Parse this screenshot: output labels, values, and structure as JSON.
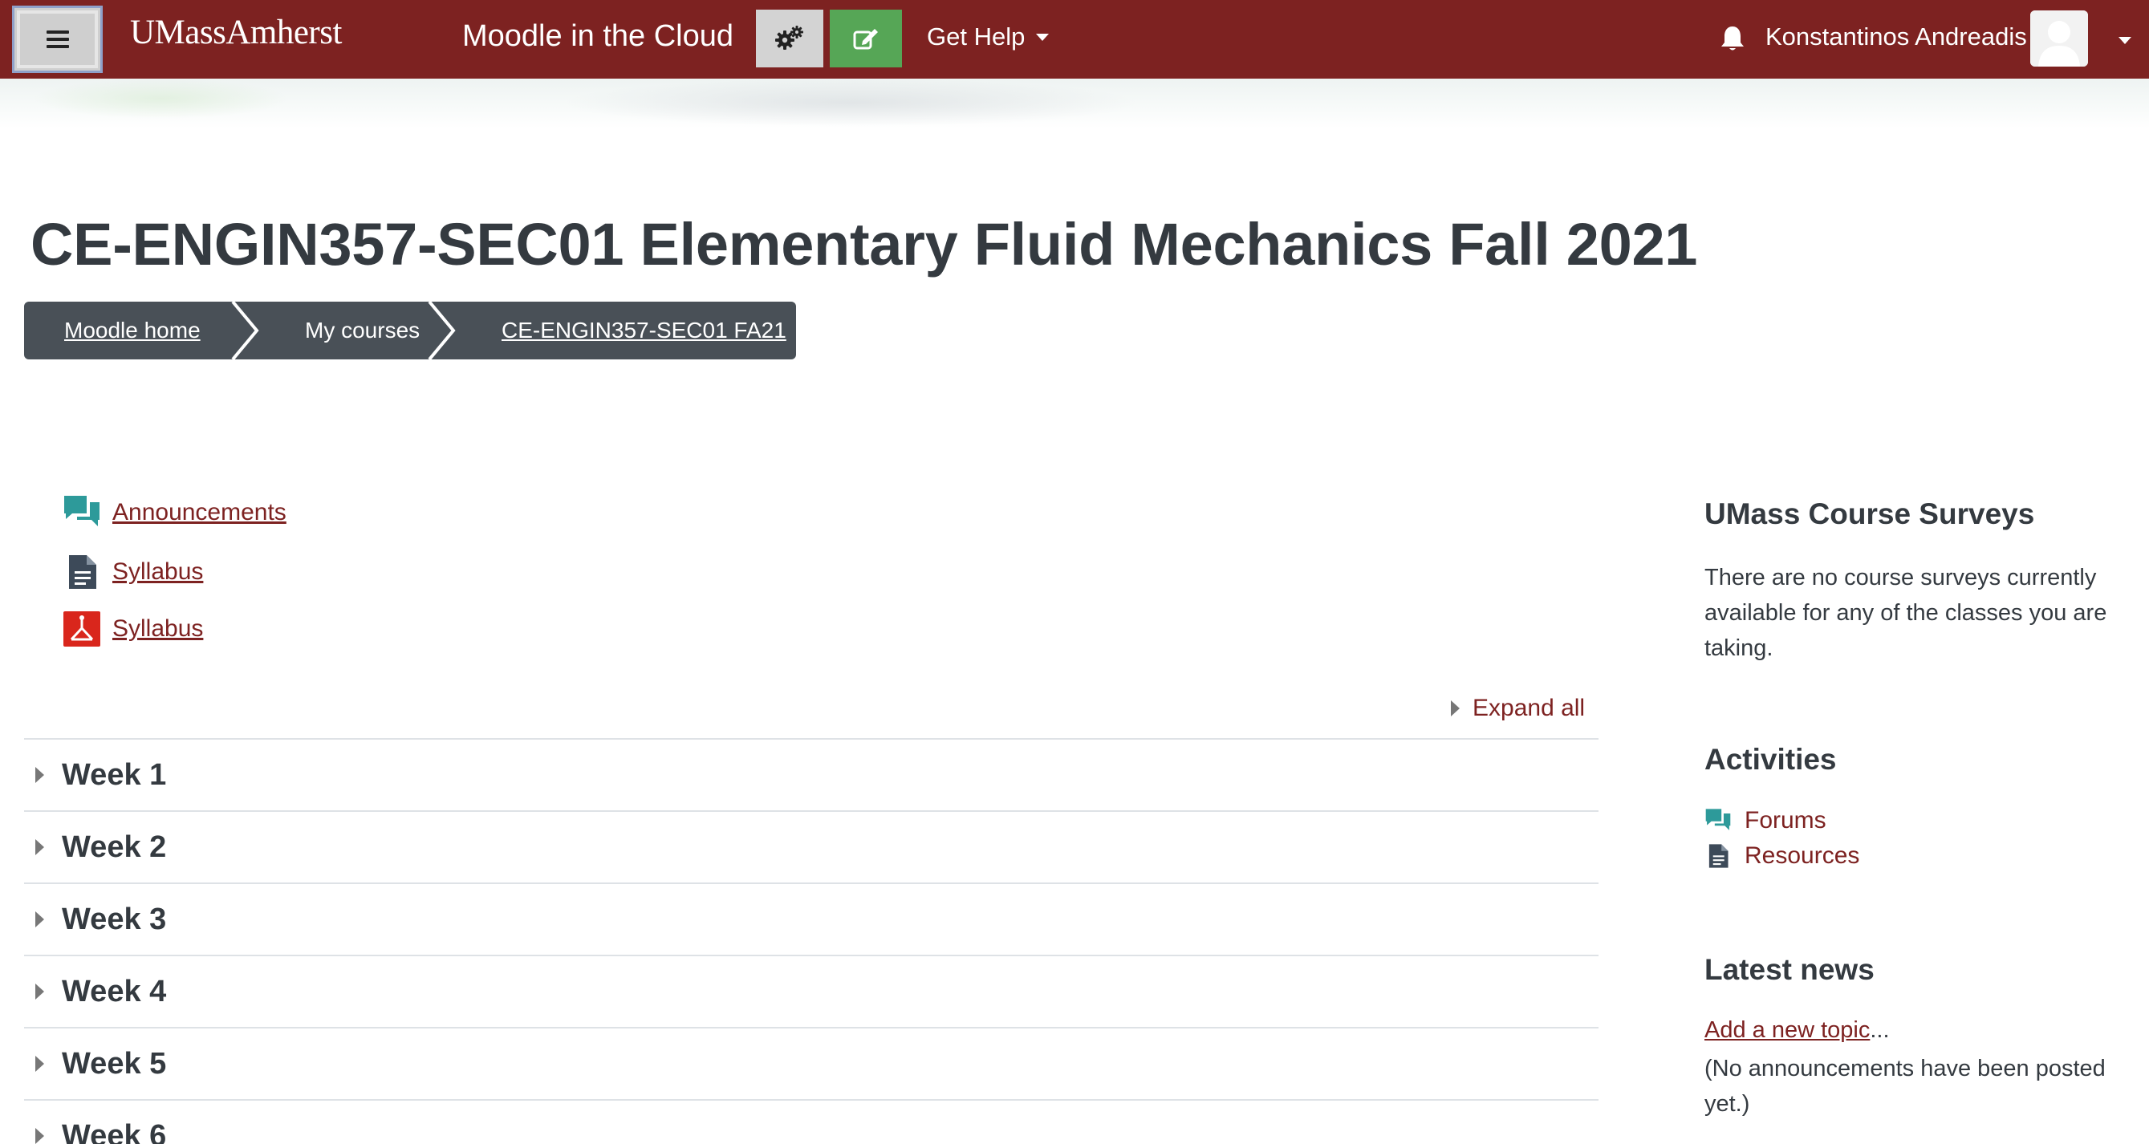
{
  "navbar": {
    "brand": "UMassAmherst",
    "site_name": "Moodle in the Cloud",
    "help_label": "Get Help",
    "user_name": "Konstantinos Andreadis",
    "color": "#7d2221"
  },
  "icons": {
    "menu": "hamburger-icon",
    "settings": "gears-icon",
    "edit": "edit-pencil-icon",
    "notifications": "bell-icon",
    "user": "avatar-icon"
  },
  "page": {
    "title": "CE-ENGIN357-SEC01 Elementary Fluid Mechanics Fall 2021"
  },
  "breadcrumb": {
    "items": [
      {
        "label": "Moodle home",
        "link": true
      },
      {
        "label": "My courses",
        "link": false
      },
      {
        "label": "CE-ENGIN357-SEC01 FA21",
        "link": true
      }
    ]
  },
  "activities": [
    {
      "label": "Announcements",
      "icon": "forum-icon"
    },
    {
      "label": "Syllabus",
      "icon": "document-icon"
    },
    {
      "label": "Syllabus",
      "icon": "pdf-icon"
    }
  ],
  "course": {
    "expand_all": "Expand all",
    "sections": [
      "Week 1",
      "Week 2",
      "Week 3",
      "Week 4",
      "Week 5",
      "Week 6"
    ]
  },
  "blocks": {
    "surveys": {
      "title": "UMass Course Surveys",
      "text": "There are no course surveys currently available for any of the classes you are taking."
    },
    "activities": {
      "title": "Activities",
      "items": [
        {
          "label": "Forums",
          "icon": "forum-icon"
        },
        {
          "label": "Resources",
          "icon": "document-icon"
        }
      ]
    },
    "news": {
      "title": "Latest news",
      "add_link": "Add a new topic",
      "add_suffix": "...",
      "empty": "(No announcements have been posted yet.)"
    }
  }
}
